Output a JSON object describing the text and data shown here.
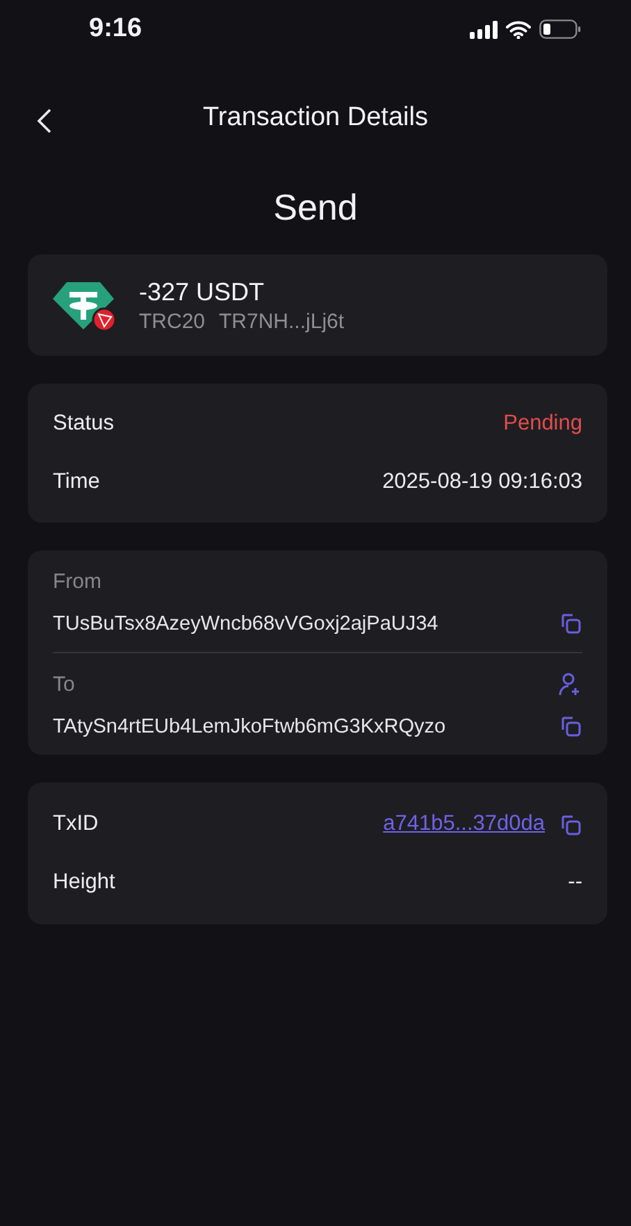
{
  "status_bar": {
    "time": "9:16"
  },
  "nav": {
    "title": "Transaction Details"
  },
  "heading": "Send",
  "asset": {
    "amount": "-327 USDT",
    "network": "TRC20",
    "address": "TR7NH...jLj6t"
  },
  "summary": [
    {
      "label": "Status",
      "value": "Pending",
      "kind": "status"
    },
    {
      "label": "Time",
      "value": "2025-08-19 09:16:03",
      "kind": "plain"
    }
  ],
  "parties": [
    {
      "label": "From",
      "address": "TUsBuTsx8AzeyWncb68vVGoxj2ajPaUJ34",
      "add_contact": false
    },
    {
      "label": "To",
      "address": "TAtySn4rtEUb4LemJkoFtwb6mG3KxRQyzo",
      "add_contact": true
    }
  ],
  "chain": [
    {
      "label": "TxID",
      "value": "a741b5...37d0da",
      "kind": "link"
    },
    {
      "label": "Height",
      "value": "--",
      "kind": "plain"
    }
  ]
}
